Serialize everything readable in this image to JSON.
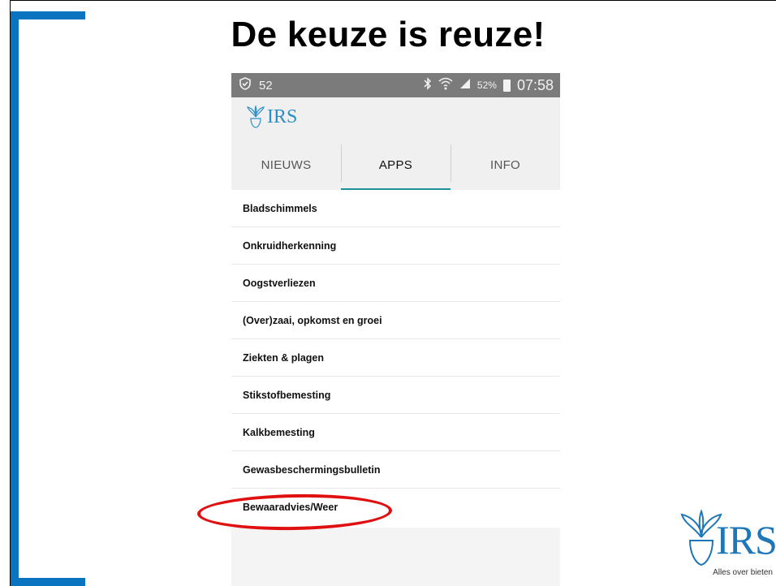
{
  "slide": {
    "title": "De keuze is reuze!",
    "accent_color": "#0b74c0"
  },
  "status_bar": {
    "shield_icon": "shield-check-icon",
    "notification_count": "52",
    "bluetooth_icon": "bluetooth-icon",
    "wifi_icon": "wifi-icon",
    "signal_icon": "signal-icon",
    "battery_percent": "52%",
    "battery_icon": "battery-icon",
    "time": "07:58"
  },
  "app": {
    "logo_text": "IRS",
    "tabs": [
      {
        "label": "NIEUWS",
        "active": false
      },
      {
        "label": "APPS",
        "active": true
      },
      {
        "label": "INFO",
        "active": false
      }
    ],
    "items": [
      {
        "label": "Bladschimmels"
      },
      {
        "label": "Onkruidherkenning"
      },
      {
        "label": "Oogstverliezen"
      },
      {
        "label": "(Over)zaai, opkomst en groei"
      },
      {
        "label": "Ziekten & plagen"
      },
      {
        "label": "Stikstofbemesting"
      },
      {
        "label": "Kalkbemesting"
      },
      {
        "label": "Gewasbeschermingsbulletin"
      },
      {
        "label": "Bewaaradvies/Weer"
      }
    ],
    "highlighted_item": "Bewaaradvies/Weer",
    "highlight_color": "#e01010"
  },
  "brand": {
    "wordmark": "IRS",
    "tagline": "Alles over bieten"
  }
}
